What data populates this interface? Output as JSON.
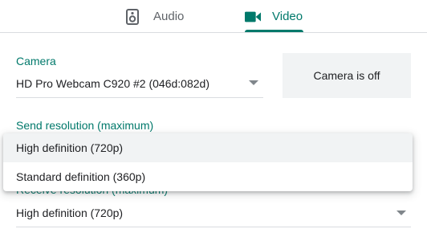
{
  "tabs": [
    {
      "label": "Audio",
      "icon": "speaker-icon",
      "active": false
    },
    {
      "label": "Video",
      "icon": "videocam-icon",
      "active": true
    }
  ],
  "accent_color": "#00796b",
  "camera": {
    "label": "Camera",
    "value": "HD Pro Webcam C920 #2 (046d:082d)"
  },
  "preview": {
    "status": "Camera is off"
  },
  "send_resolution": {
    "label": "Send resolution (maximum)",
    "options": [
      {
        "label": "High definition (720p)",
        "selected": true
      },
      {
        "label": "Standard definition (360p)",
        "selected": false
      }
    ]
  },
  "receive_resolution": {
    "label": "Receive resolution (maximum)",
    "value": "High definition (720p)"
  }
}
